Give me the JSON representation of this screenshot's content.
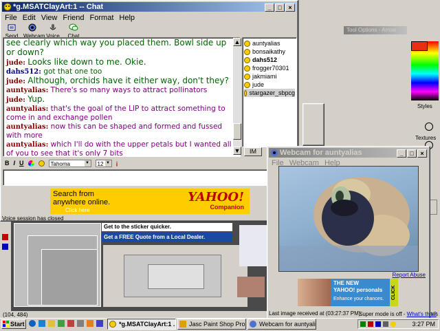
{
  "chat_window": {
    "title": "*g.MSATClayArt:1 -- Chat",
    "menu": [
      "File",
      "Edit",
      "View",
      "Friend",
      "Format",
      "Help"
    ],
    "toolbar": [
      {
        "label": "Send File",
        "icon": "send-file-icon"
      },
      {
        "label": "Webcam",
        "icon": "webcam-icon"
      },
      {
        "label": "Voice",
        "icon": "voice-icon"
      },
      {
        "label": "Chat",
        "icon": "chat-icon"
      }
    ],
    "messages": [
      {
        "nick": "",
        "text": "see clearly which way you placed them. Bowl side up or down?",
        "style": "green"
      },
      {
        "nick": "jude:",
        "text": "Looks like down to me. Okie.",
        "style": "green"
      },
      {
        "nick": "dahs512:",
        "text": "got that one too",
        "style": "blue"
      },
      {
        "nick": "jude:",
        "text": "Although, orchids have it either way, don't they?",
        "style": "green"
      },
      {
        "nick": "auntyalias:",
        "text": "There's so many ways to attract pollinators",
        "style": "purple"
      },
      {
        "nick": "jude:",
        "text": "Yup.",
        "style": "green"
      },
      {
        "nick": "auntyalias:",
        "text": "that's the goal of the LIP to attract something to come in and exchange pollen",
        "style": "purple"
      },
      {
        "nick": "auntyalias:",
        "text": "now this can be shaped and formed and fussed with more",
        "style": "purple"
      },
      {
        "nick": "auntyalias:",
        "text": "which I'll do with the upper petals but I wanted all of you to see that it's only 7 bits",
        "style": "purple"
      }
    ],
    "users": [
      "auntyalias",
      "bonsaikathy",
      "dahs512",
      "frogger70301",
      "jakmiami",
      "jude",
      "stargazer_sbpcg"
    ],
    "im_button": "IM",
    "format_bar": {
      "bold": "B",
      "italic": "I",
      "underline": "U",
      "font": "Tahoma",
      "size": "12"
    },
    "ad": {
      "line1": "Search from",
      "line2": "anywhere online.",
      "link": "Click here",
      "brand": "YAHOO!",
      "sub": "Companion"
    },
    "status": "Voice session has closed"
  },
  "webcam_window": {
    "title": "Webcam for auntyalias",
    "menu": [
      "File",
      "Webcam",
      "Help"
    ],
    "report_abuse": "Report Abuse",
    "ad": {
      "line1": "THE NEW",
      "brand": "YAHOO! personals",
      "line2": "Enhance your chances.",
      "click": "CLICK"
    },
    "status": "Last image received at (03:27:37 PM)"
  },
  "background": {
    "coords": "(104, 484)",
    "sticker_text": "Get to the sticker quicker.",
    "quote_text": "Get a FREE Quote from a Local Dealer.",
    "tool_options": "Tool Options - Arrow",
    "styles": "Styles",
    "textures": "Textures",
    "bytes": "Bytes",
    "super_mode": "Super mode is off - ",
    "whats_this": "What's this?"
  },
  "taskbar": {
    "start": "Start",
    "tasks": [
      "*g.MSATClayArt:1 ...",
      "Jasc Paint Shop Pro - Ima...",
      "Webcam for auntyalias"
    ],
    "time": "3:27 PM"
  },
  "colors": {
    "title_active": "#0a246a",
    "nick": "#800000",
    "yahoo": "#ffcc00"
  }
}
